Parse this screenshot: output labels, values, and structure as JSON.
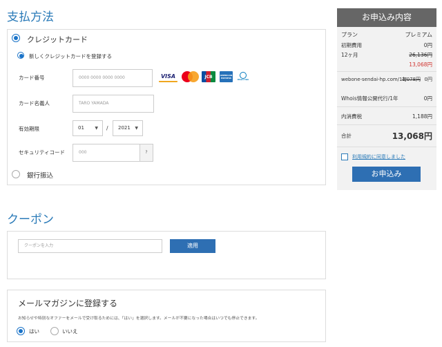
{
  "payment": {
    "title": "支払方法",
    "credit_label": "クレジットカード",
    "new_card_label": "新しくクレジットカードを登録する",
    "card_number_label": "カード番号",
    "card_number_placeholder": "0000 0000 0000 0000",
    "card_name_label": "カード名義人",
    "card_name_placeholder": "TARO YAMADA",
    "expiry_label": "有効期限",
    "expiry_month": "01",
    "expiry_sep": "/",
    "expiry_year": "2021",
    "security_label": "セキュリティコード",
    "security_placeholder": "000",
    "security_help": "?",
    "bank_label": "銀行振込",
    "card_brands": [
      "VISA",
      "mastercard",
      "JCB",
      "AMERICAN EXPRESS",
      "Diners Club"
    ]
  },
  "coupon": {
    "title": "クーポン",
    "placeholder": "クーポンを入力",
    "apply_label": "適用"
  },
  "newsletter": {
    "title": "メールマガジンに登録する",
    "desc": "お知らせや特別なオファーをメールで受け取るためには、「はい」を選択します。メールが不要になった場合はいつでも停止できます。",
    "yes_label": "はい",
    "no_label": "いいえ"
  },
  "summary": {
    "title": "お申込み内容",
    "plan_label": "プラン",
    "plan_value": "プレミアム",
    "initial_label": "初期費用",
    "initial_value": "0円",
    "months_label": "12ヶ月",
    "months_old": "26,136円",
    "months_new": "13,068円",
    "domain_label": "webone-sendai-hp.com/1年",
    "domain_old": "1,078円",
    "domain_new": "0円",
    "whois_label": "Whois情報公開代行/1年",
    "whois_value": "0円",
    "tax_label": "内消費税",
    "tax_value": "1,188円",
    "total_label": "合計",
    "total_value": "13,068円",
    "terms_label": "利用規約に同意しました",
    "submit_label": "お申込み"
  },
  "colors": {
    "accent": "#2a7ab8",
    "button": "#2e6fb3",
    "sale": "#d0312d"
  }
}
